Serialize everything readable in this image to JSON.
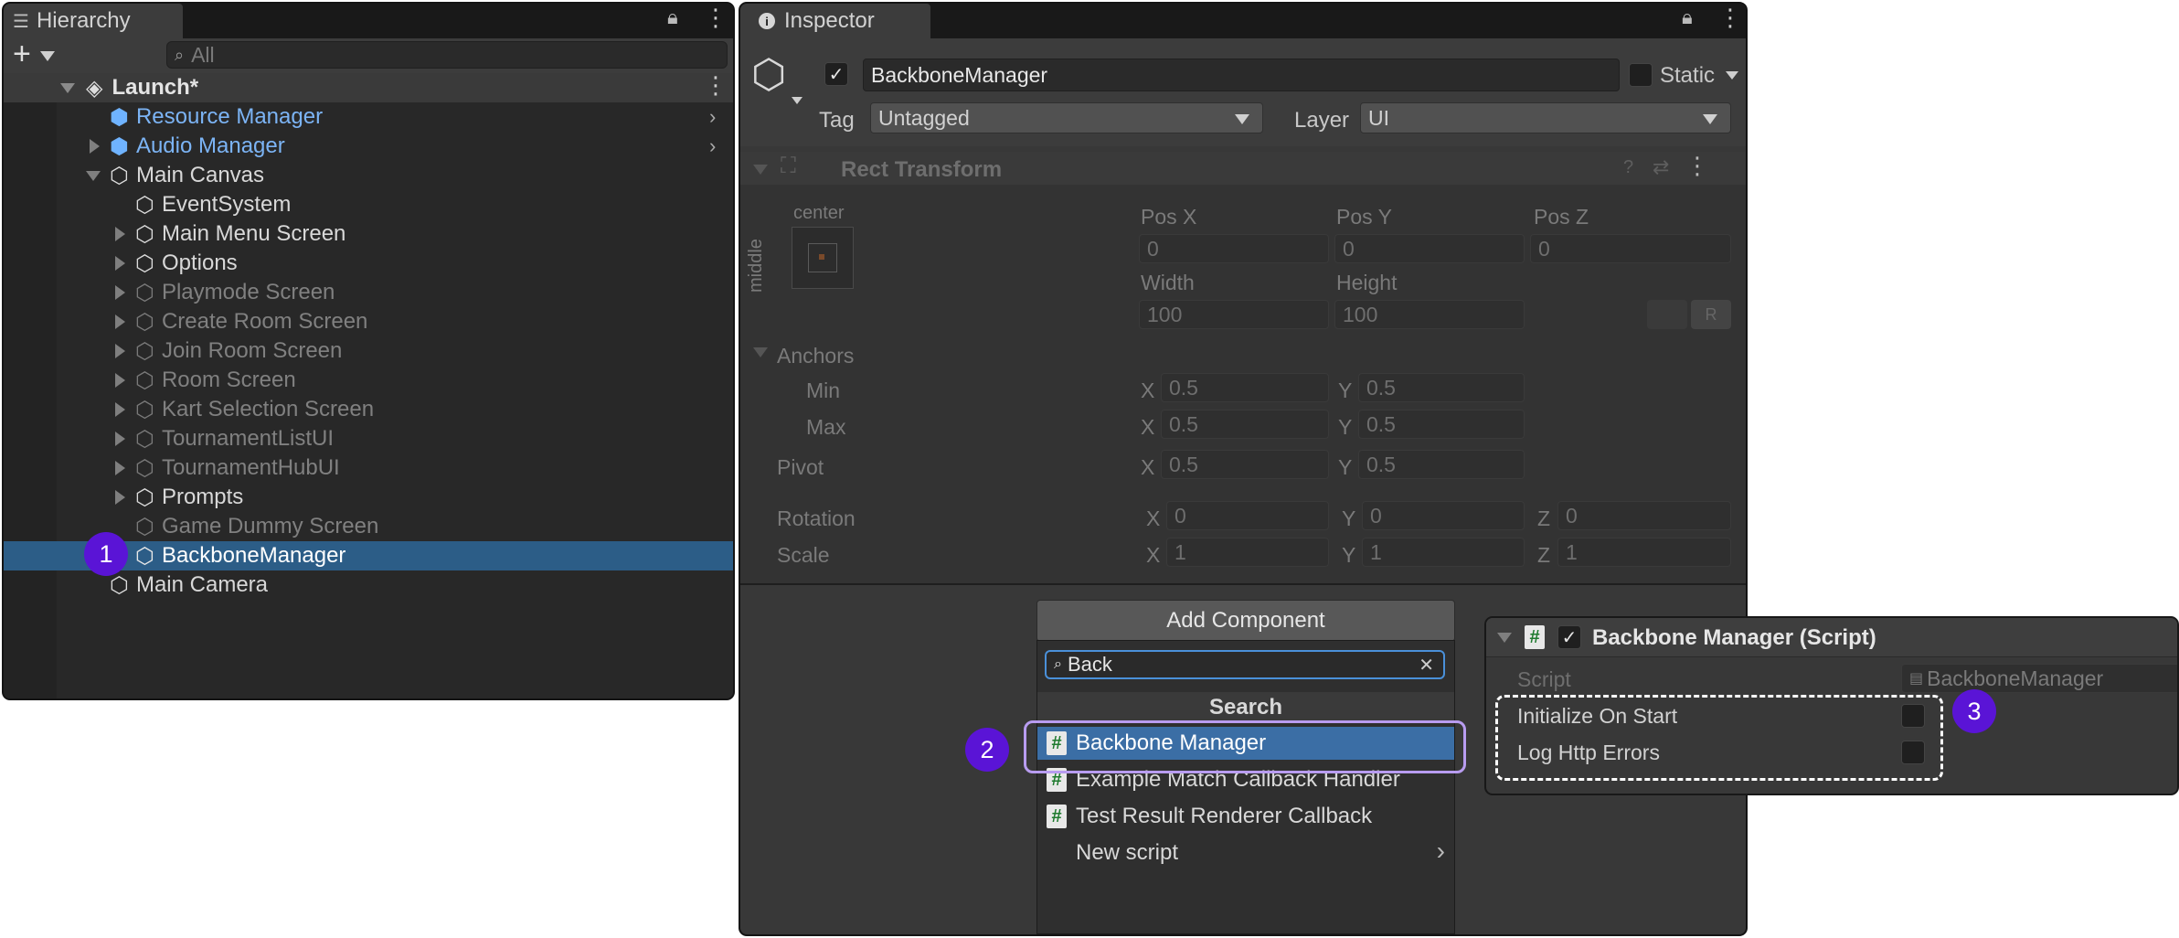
{
  "hierarchy": {
    "tab_title": "Hierarchy",
    "add_label": "+",
    "search_placeholder": "All",
    "scene_name": "Launch*",
    "items": [
      {
        "label": "Resource Manager"
      },
      {
        "label": "Audio Manager"
      },
      {
        "label": "Main Canvas"
      },
      {
        "label": "EventSystem"
      },
      {
        "label": "Main Menu Screen"
      },
      {
        "label": "Options"
      },
      {
        "label": "Playmode Screen"
      },
      {
        "label": "Create Room Screen"
      },
      {
        "label": "Join Room Screen"
      },
      {
        "label": "Room Screen"
      },
      {
        "label": "Kart Selection Screen"
      },
      {
        "label": "TournamentListUI"
      },
      {
        "label": "TournamentHubUI"
      },
      {
        "label": "Prompts"
      },
      {
        "label": "Game Dummy Screen"
      },
      {
        "label": "BackboneManager"
      },
      {
        "label": "Main Camera"
      }
    ]
  },
  "inspector": {
    "tab_title": "Inspector",
    "object_name": "BackboneManager",
    "static_label": "Static",
    "tag_label": "Tag",
    "tag_value": "Untagged",
    "layer_label": "Layer",
    "layer_value": "UI",
    "rect_transform": {
      "title": "Rect Transform",
      "anchor_h": "center",
      "anchor_v": "middle",
      "pos_x_label": "Pos X",
      "pos_y_label": "Pos Y",
      "pos_z_label": "Pos Z",
      "pos_x": "0",
      "pos_y": "0",
      "pos_z": "0",
      "width_label": "Width",
      "height_label": "Height",
      "width": "100",
      "height": "100",
      "r_label": "R",
      "anchors_label": "Anchors",
      "min_label": "Min",
      "max_label": "Max",
      "pivot_label": "Pivot",
      "x_label": "X",
      "y_label": "Y",
      "z_label": "Z",
      "min_x": "0.5",
      "min_y": "0.5",
      "max_x": "0.5",
      "max_y": "0.5",
      "pivot_x": "0.5",
      "pivot_y": "0.5",
      "rotation_label": "Rotation",
      "rot_x": "0",
      "rot_y": "0",
      "rot_z": "0",
      "scale_label": "Scale",
      "scale_x": "1",
      "scale_y": "1",
      "scale_z": "1"
    }
  },
  "add_component": {
    "button_label": "Add Component",
    "search_value": "Back",
    "results_header": "Search",
    "results": [
      {
        "label": "Backbone Manager"
      },
      {
        "label": "Example Match Callback Handler"
      },
      {
        "label": "Test Result Renderer Callback"
      }
    ],
    "new_script_label": "New script"
  },
  "script_component": {
    "title": "Backbone Manager (Script)",
    "script_label": "Script",
    "script_value": "BackboneManager",
    "fields": [
      {
        "label": "Initialize On Start"
      },
      {
        "label": "Log Http Errors"
      }
    ]
  },
  "callouts": {
    "one": "1",
    "two": "2",
    "three": "3"
  },
  "colors": {
    "panel_bg": "#282828",
    "selection": "#2c5d87",
    "prefab_blue": "#7cb4f5",
    "callout": "#5a14d6"
  }
}
